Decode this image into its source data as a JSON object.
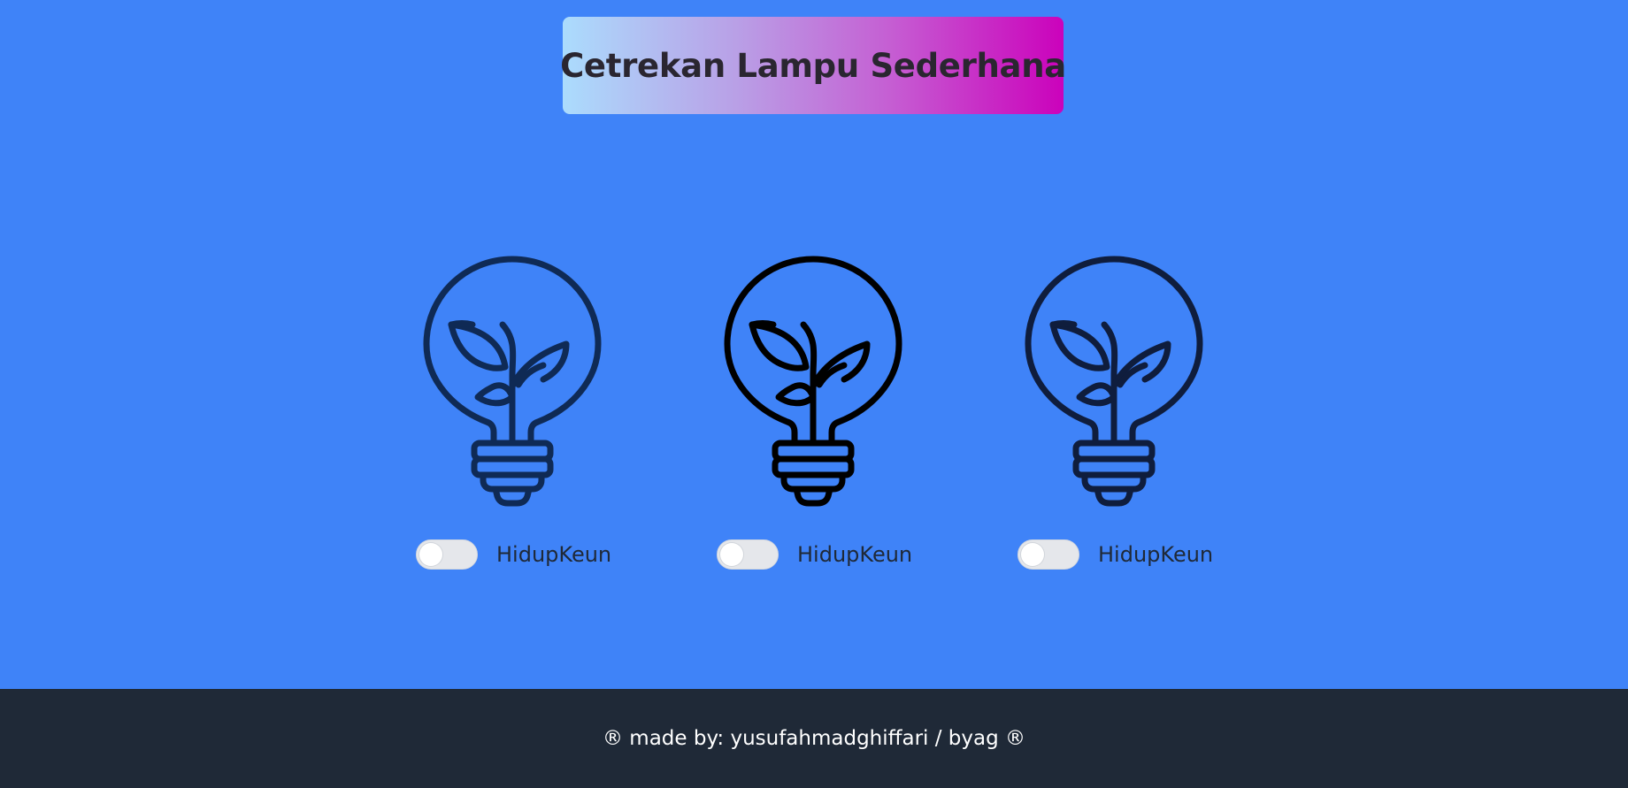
{
  "header": {
    "title": "Cetrekan Lampu Sederhana",
    "gradient_colors": [
      "#abdcfd",
      "#cb02bb"
    ]
  },
  "lamps": [
    {
      "icon": "lightbulb-plant-icon",
      "stroke_color": "#0f2a55",
      "switch_on": false,
      "label": "HidupKeun"
    },
    {
      "icon": "lightbulb-plant-icon",
      "stroke_color": "#000000",
      "switch_on": false,
      "label": "HidupKeun"
    },
    {
      "icon": "lightbulb-plant-icon",
      "stroke_color": "#0f1d3d",
      "switch_on": false,
      "label": "HidupKeun"
    }
  ],
  "footer": {
    "text": "® made by: yusufahmadghiffari / byag ®"
  },
  "colors": {
    "background": "#3f83f8",
    "footer_background": "#1f2937"
  }
}
